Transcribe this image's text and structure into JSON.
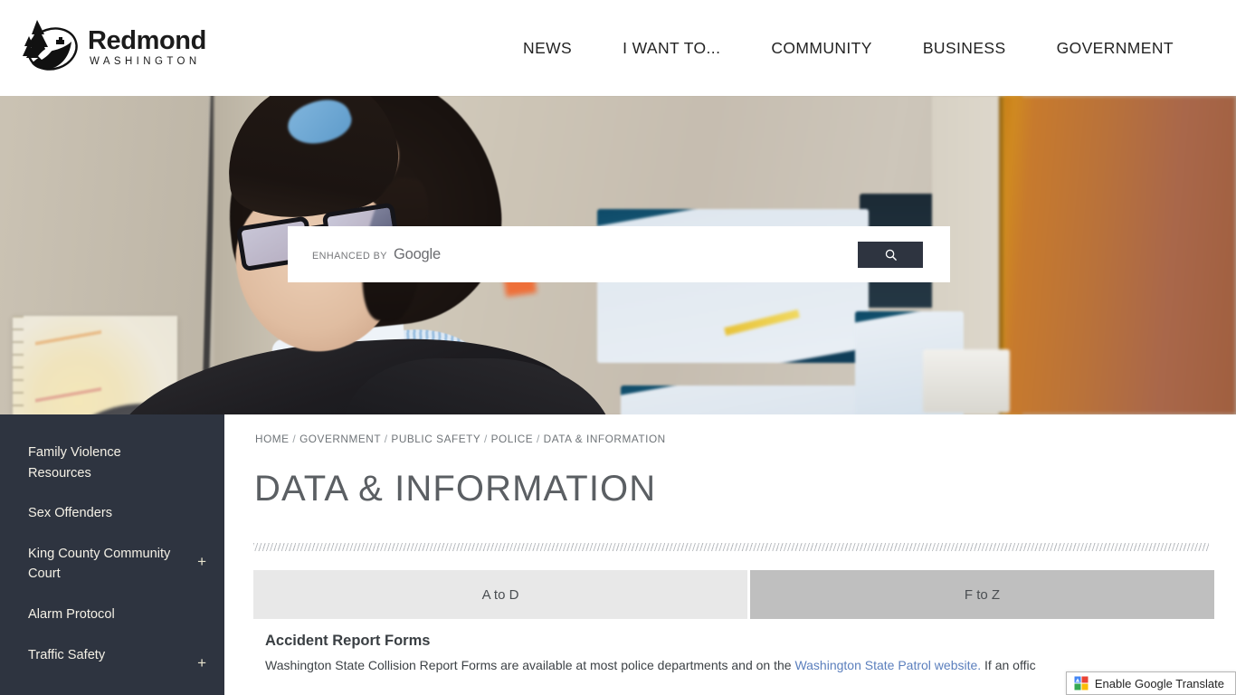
{
  "header": {
    "logo": {
      "name": "Redmond",
      "subtitle": "WASHINGTON",
      "icon": "redmond-mountain-logo"
    },
    "nav": [
      {
        "label": "NEWS",
        "name": "nav-news"
      },
      {
        "label": "I WANT TO...",
        "name": "nav-i-want-to"
      },
      {
        "label": "COMMUNITY",
        "name": "nav-community"
      },
      {
        "label": "BUSINESS",
        "name": "nav-business"
      },
      {
        "label": "GOVERNMENT",
        "name": "nav-government"
      }
    ]
  },
  "hero": {
    "alt": "City employee working at a desk with computer monitors in an office cubicle",
    "search": {
      "value": "",
      "placeholder": "",
      "enhanced_label": "ENHANCED BY",
      "google_label": "Google",
      "button_icon": "search-icon"
    }
  },
  "sidebar": {
    "items": [
      {
        "label": "Family Violence Resources",
        "expandable": false,
        "plus": ""
      },
      {
        "label": "Sex Offenders",
        "expandable": false,
        "plus": ""
      },
      {
        "label": "King County Community Court",
        "expandable": true,
        "plus": "+"
      },
      {
        "label": "Alarm Protocol",
        "expandable": false,
        "plus": ""
      },
      {
        "label": "Traffic Safety",
        "expandable": true,
        "plus": "+"
      }
    ]
  },
  "main": {
    "breadcrumb": [
      {
        "label": "HOME",
        "link": true
      },
      {
        "label": "/",
        "link": false
      },
      {
        "label": "GOVERNMENT",
        "link": true
      },
      {
        "label": "/",
        "link": false
      },
      {
        "label": "PUBLIC SAFETY",
        "link": true
      },
      {
        "label": "/",
        "link": false
      },
      {
        "label": "POLICE",
        "link": true
      },
      {
        "label": "/",
        "link": false
      },
      {
        "label": "DATA & INFORMATION",
        "link": false
      }
    ],
    "title": "DATA & INFORMATION",
    "tabs": [
      {
        "label": "A to D",
        "active": true
      },
      {
        "label": "F to Z",
        "active": false
      }
    ],
    "article": {
      "heading": "Accident Report Forms",
      "text_before": "Washington State Collision Report Forms are available at most police departments and on the ",
      "link_text": "Washington State Patrol website.",
      "text_after": " If an offic"
    }
  },
  "translate": {
    "label": "Enable Google Translate",
    "icon": "google-translate-icon"
  },
  "colors": {
    "sidebar_bg": "#2e3440",
    "search_button": "#2e3440",
    "tab_active": "#e8e8e8",
    "tab_inactive": "#bfbfbf",
    "link_blue": "#5b7fbd",
    "title_gray": "#5b5f63"
  }
}
